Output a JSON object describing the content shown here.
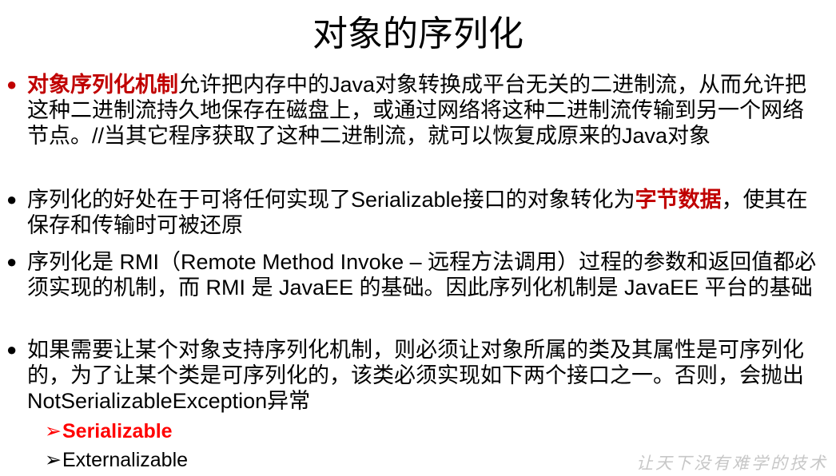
{
  "title": "对象的序列化",
  "bullets": [
    {
      "highlight": "对象序列化机制",
      "text": "允许把内存中的Java对象转换成平台无关的二进制流，从而允许把这种二进制流持久地保存在磁盘上，或通过网络将这种二进制流传输到另一个网络节点。//当其它程序获取了这种二进制流，就可以恢复成原来的Java对象"
    },
    {
      "text_before": "序列化的好处在于可将任何实现了Serializable接口的对象转化为",
      "highlight": "字节数据",
      "text_after": "，使其在保存和传输时可被还原"
    },
    {
      "text": "序列化是 RMI（Remote Method Invoke – 远程方法调用）过程的参数和返回值都必须实现的机制，而 RMI 是 JavaEE 的基础。因此序列化机制是 JavaEE 平台的基础"
    },
    {
      "text": "如果需要让某个对象支持序列化机制，则必须让对象所属的类及其属性是可序列化的，为了让某个类是可序列化的，该类必须实现如下两个接口之一。否则，会抛出NotSerializableException异常"
    }
  ],
  "sub_items": [
    {
      "label": "Serializable"
    },
    {
      "label": "Externalizable"
    }
  ],
  "watermark": "让天下没有难学的技术",
  "icons": {
    "bullet": "●",
    "arrow": "➢"
  },
  "colors": {
    "highlight": "#c00000",
    "sub_highlight": "#ff0000",
    "watermark": "#c7c7c7"
  }
}
